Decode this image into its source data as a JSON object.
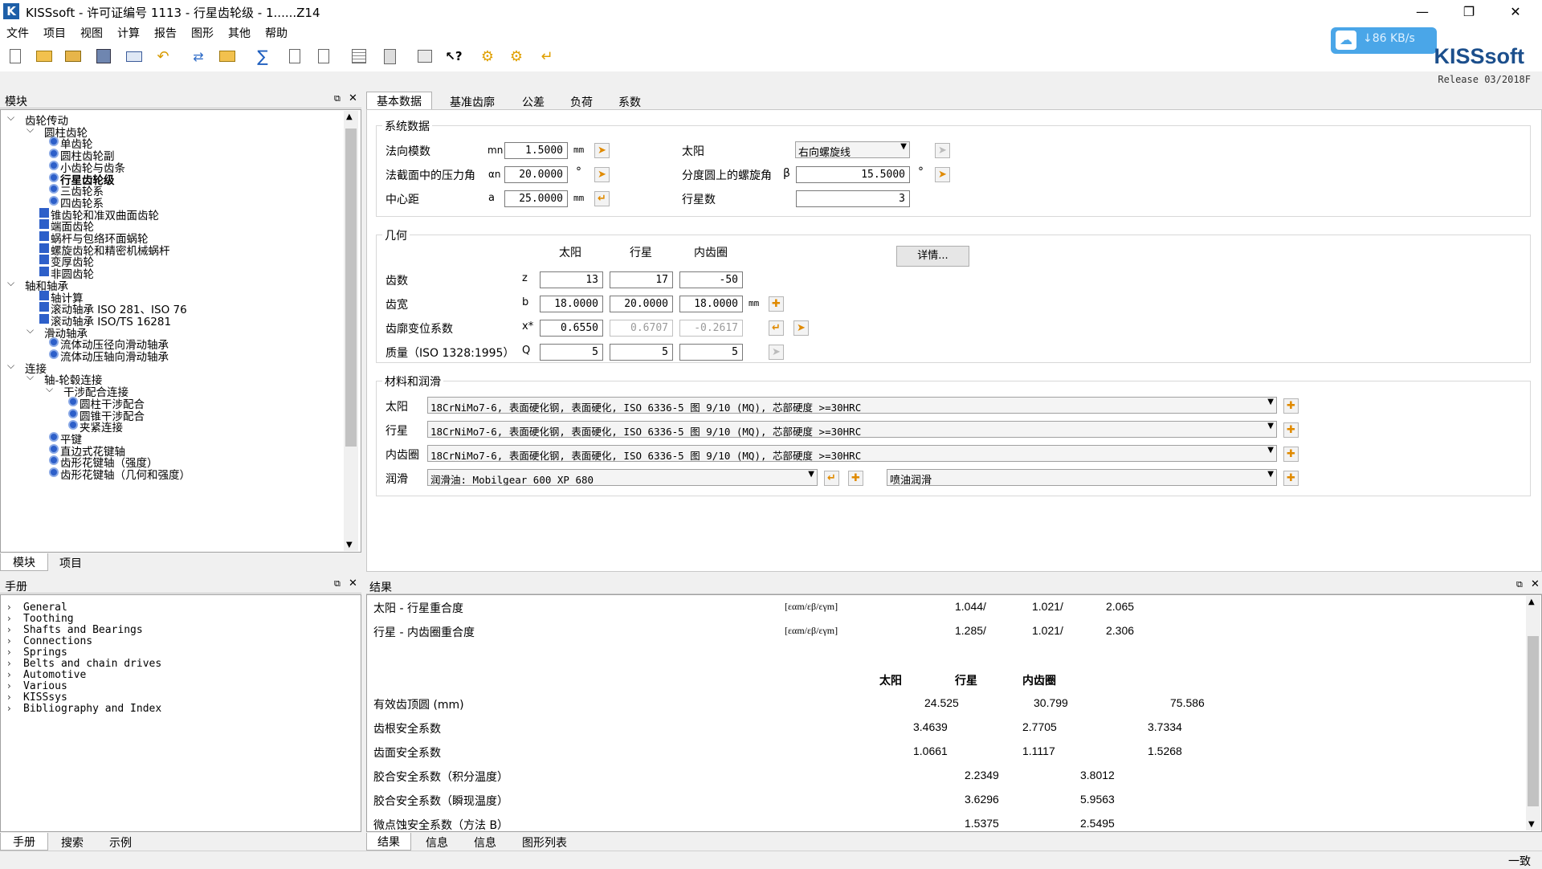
{
  "window": {
    "title": "KISSsoft - 许可证编号 1113 - 行星齿轮级 - 1......Z14",
    "icon_letter": "K"
  },
  "menu": [
    "文件",
    "项目",
    "视图",
    "计算",
    "报告",
    "图形",
    "其他",
    "帮助"
  ],
  "speed": "↓86 KB/s",
  "logo": "KISSsoft",
  "release": "Release 03/2018F",
  "module_panel": {
    "title": "模块",
    "tabs": [
      "模块",
      "项目"
    ],
    "tree": [
      {
        "label": "齿轮传动",
        "level": 0,
        "arrow": "v"
      },
      {
        "label": "圆柱齿轮",
        "level": 1,
        "arrow": "v"
      },
      {
        "label": "单齿轮",
        "level": 2
      },
      {
        "label": "圆柱齿轮副",
        "level": 2
      },
      {
        "label": "小齿轮与齿条",
        "level": 2
      },
      {
        "label": "行星齿轮级",
        "level": 2,
        "bold": true
      },
      {
        "label": "三齿轮系",
        "level": 2
      },
      {
        "label": "四齿轮系",
        "level": 2
      },
      {
        "label": "锥齿轮和准双曲面齿轮",
        "level": 1.5
      },
      {
        "label": "端面齿轮",
        "level": 1.5
      },
      {
        "label": "蜗杆与包络环面蜗轮",
        "level": 1.5
      },
      {
        "label": "螺旋齿轮和精密机械蜗杆",
        "level": 1.5
      },
      {
        "label": "变厚齿轮",
        "level": 1.5
      },
      {
        "label": "非圆齿轮",
        "level": 1.5
      },
      {
        "label": "轴和轴承",
        "level": 0,
        "arrow": "v"
      },
      {
        "label": "轴计算",
        "level": 1.5
      },
      {
        "label": "滚动轴承 ISO 281、ISO 76",
        "level": 1.5
      },
      {
        "label": "滚动轴承 ISO/TS 16281",
        "level": 1.5
      },
      {
        "label": "滑动轴承",
        "level": 1,
        "arrow": "v"
      },
      {
        "label": "流体动压径向滑动轴承",
        "level": 2
      },
      {
        "label": "流体动压轴向滑动轴承",
        "level": 2
      },
      {
        "label": "连接",
        "level": 0,
        "arrow": "v"
      },
      {
        "label": "轴-轮毂连接",
        "level": 1,
        "arrow": "v"
      },
      {
        "label": "干涉配合连接",
        "level": 2,
        "arrow": "v"
      },
      {
        "label": "圆柱干涉配合",
        "level": 3
      },
      {
        "label": "圆锥干涉配合",
        "level": 3
      },
      {
        "label": "夹紧连接",
        "level": 3
      },
      {
        "label": "平键",
        "level": 2
      },
      {
        "label": "直边式花键轴",
        "level": 2
      },
      {
        "label": "齿形花键轴（强度）",
        "level": 2
      },
      {
        "label": "齿形花键轴（几何和强度）",
        "level": 2
      }
    ]
  },
  "manual_panel": {
    "title": "手册",
    "tabs": [
      "手册",
      "搜索",
      "示例"
    ],
    "items": [
      "General",
      "Toothing",
      "Shafts and Bearings",
      "Connections",
      "Springs",
      "Belts and chain drives",
      "Automotive",
      "Various",
      "KISSsys",
      "Bibliography and Index"
    ]
  },
  "main_tabs": [
    "基本数据",
    "基准齿廓",
    "公差",
    "负荷",
    "系数"
  ],
  "system": {
    "title": "系统数据",
    "mn_label": "法向模数",
    "mn_sym": "mn",
    "mn_val": "1.5000",
    "mn_unit": "mm",
    "alpha_label": "法截面中的压力角",
    "alpha_sym": "αn",
    "alpha_val": "20.0000",
    "alpha_unit": "°",
    "a_label": "中心距",
    "a_sym": "a",
    "a_val": "25.0000",
    "a_unit": "mm",
    "sun_label": "太阳",
    "sun_sel": "右向螺旋线",
    "beta_label": "分度圆上的螺旋角",
    "beta_sym": "β",
    "beta_val": "15.5000",
    "beta_unit": "°",
    "np_label": "行星数",
    "np_val": "3"
  },
  "geometry": {
    "title": "几何",
    "col_sun": "太阳",
    "col_planet": "行星",
    "col_ring": "内齿圈",
    "detail_btn": "详情...",
    "rows": [
      {
        "label": "齿数",
        "sym": "z",
        "v": [
          "13",
          "17",
          "-50"
        ],
        "unit": ""
      },
      {
        "label": "齿宽",
        "sym": "b",
        "v": [
          "18.0000",
          "20.0000",
          "18.0000"
        ],
        "unit": "mm"
      },
      {
        "label": "齿廓变位系数",
        "sym": "x*",
        "v": [
          "0.6550",
          "0.6707",
          "-0.2617"
        ],
        "unit": ""
      },
      {
        "label": "质量（ISO 1328:1995）",
        "sym": "Q",
        "v": [
          "5",
          "5",
          "5"
        ],
        "unit": ""
      }
    ]
  },
  "material": {
    "title": "材料和润滑",
    "rows": [
      {
        "label": "太阳",
        "val": "18CrNiMo7-6, 表面硬化钢, 表面硬化, ISO 6336-5 图 9/10 (MQ), 芯部硬度 >=30HRC"
      },
      {
        "label": "行星",
        "val": "18CrNiMo7-6, 表面硬化钢, 表面硬化, ISO 6336-5 图 9/10 (MQ), 芯部硬度 >=30HRC"
      },
      {
        "label": "内齿圈",
        "val": "18CrNiMo7-6, 表面硬化钢, 表面硬化, ISO 6336-5 图 9/10 (MQ), 芯部硬度 >=30HRC"
      }
    ],
    "lub_label": "润滑",
    "lub_val": "润滑油: Mobilgear 600 XP 680",
    "lub_type": "喷油润滑"
  },
  "results": {
    "title": "结果",
    "tabs": [
      "结果",
      "信息",
      "信息",
      "图形列表"
    ],
    "overlap": [
      {
        "label": "太阳 - 行星重合度",
        "sym": "[εαm/εβ/εγm]",
        "v": [
          "1.044/",
          "1.021/",
          "2.065"
        ]
      },
      {
        "label": "行星 - 内齿圈重合度",
        "sym": "[εαm/εβ/εγm]",
        "v": [
          "1.285/",
          "1.021/",
          "2.306"
        ]
      }
    ],
    "col_sun": "太阳",
    "col_planet": "行星",
    "col_ring": "内齿圈",
    "rows": [
      {
        "label": "有效齿顶圆 (mm)",
        "v": [
          "24.525",
          "30.799",
          "75.586"
        ]
      },
      {
        "label": "齿根安全系数",
        "v": [
          "3.4639",
          "2.7705",
          "3.7334"
        ]
      },
      {
        "label": "齿面安全系数",
        "v": [
          "1.0661",
          "1.1117",
          "1.5268"
        ]
      },
      {
        "label": "胶合安全系数（积分温度）",
        "v": [
          "2.2349",
          "3.8012"
        ]
      },
      {
        "label": "胶合安全系数（瞬现温度）",
        "v": [
          "3.6296",
          "5.9563"
        ]
      },
      {
        "label": "微点蚀安全系数（方法 B）",
        "v": [
          "1.5375",
          "2.5495"
        ]
      }
    ]
  },
  "status": "一致"
}
